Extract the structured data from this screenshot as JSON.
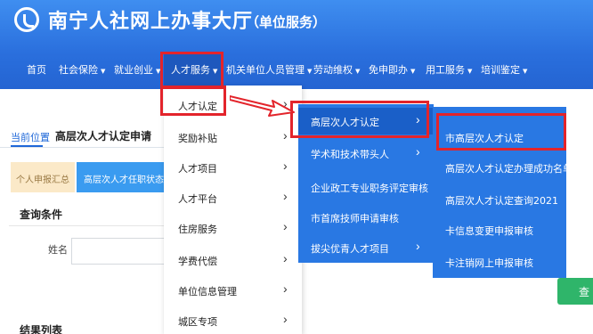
{
  "header": {
    "title": "南宁人社网上办事大厅",
    "subtitle": "（单位服务）"
  },
  "nav": {
    "items": [
      {
        "label": "首页",
        "caret": ""
      },
      {
        "label": "社会保险",
        "caret": "▼"
      },
      {
        "label": "就业创业",
        "caret": "▼"
      },
      {
        "label": "人才服务",
        "caret": "▼"
      },
      {
        "label": "机关单位人员管理",
        "caret": "▼"
      },
      {
        "label": "劳动维权",
        "caret": "▼"
      },
      {
        "label": "免申即办",
        "caret": "▼"
      },
      {
        "label": "用工服务",
        "caret": "▼"
      },
      {
        "label": "培训鉴定",
        "caret": "▼"
      }
    ]
  },
  "breadcrumb": {
    "label": "当前位置",
    "current": "高层次人才认定申请"
  },
  "tabs": [
    {
      "label": "个人申报汇总"
    },
    {
      "label": "高层次人才任职状态确"
    }
  ],
  "query": {
    "title": "查询条件",
    "name_label": "姓名",
    "button_label": "查"
  },
  "results": {
    "title": "结果列表"
  },
  "menu_level1": [
    {
      "label": "人才认定",
      "chevron": "›"
    },
    {
      "label": "奖励补贴",
      "chevron": "›"
    },
    {
      "label": "人才项目",
      "chevron": "›"
    },
    {
      "label": "人才平台",
      "chevron": "›"
    },
    {
      "label": "住房服务",
      "chevron": "›"
    },
    {
      "label": "学费代偿",
      "chevron": "›"
    },
    {
      "label": "单位信息管理",
      "chevron": "›"
    },
    {
      "label": "城区专项",
      "chevron": "›"
    }
  ],
  "menu_level2": [
    {
      "label": "高层次人才认定",
      "chevron": "›"
    },
    {
      "label": "学术和技术带头人",
      "chevron": "›"
    },
    {
      "label": "企业政工专业职务评定审核",
      "chevron": ""
    },
    {
      "label": "市首席技师申请审核",
      "chevron": ""
    },
    {
      "label": "拔尖优青人才项目",
      "chevron": "›"
    }
  ],
  "menu_level3": [
    {
      "label": "市高层次人才认定"
    },
    {
      "label": "高层次人才认定办理成功名单"
    },
    {
      "label": "高层次人才认定查询2021"
    },
    {
      "label": "卡信息变更申报审核"
    },
    {
      "label": "卡注销网上申报审核"
    }
  ],
  "colors": {
    "header_blue": "#2a6fdd",
    "menu_blue": "#2978e3",
    "highlight_red": "#e3242b",
    "button_green": "#2fb56a"
  }
}
